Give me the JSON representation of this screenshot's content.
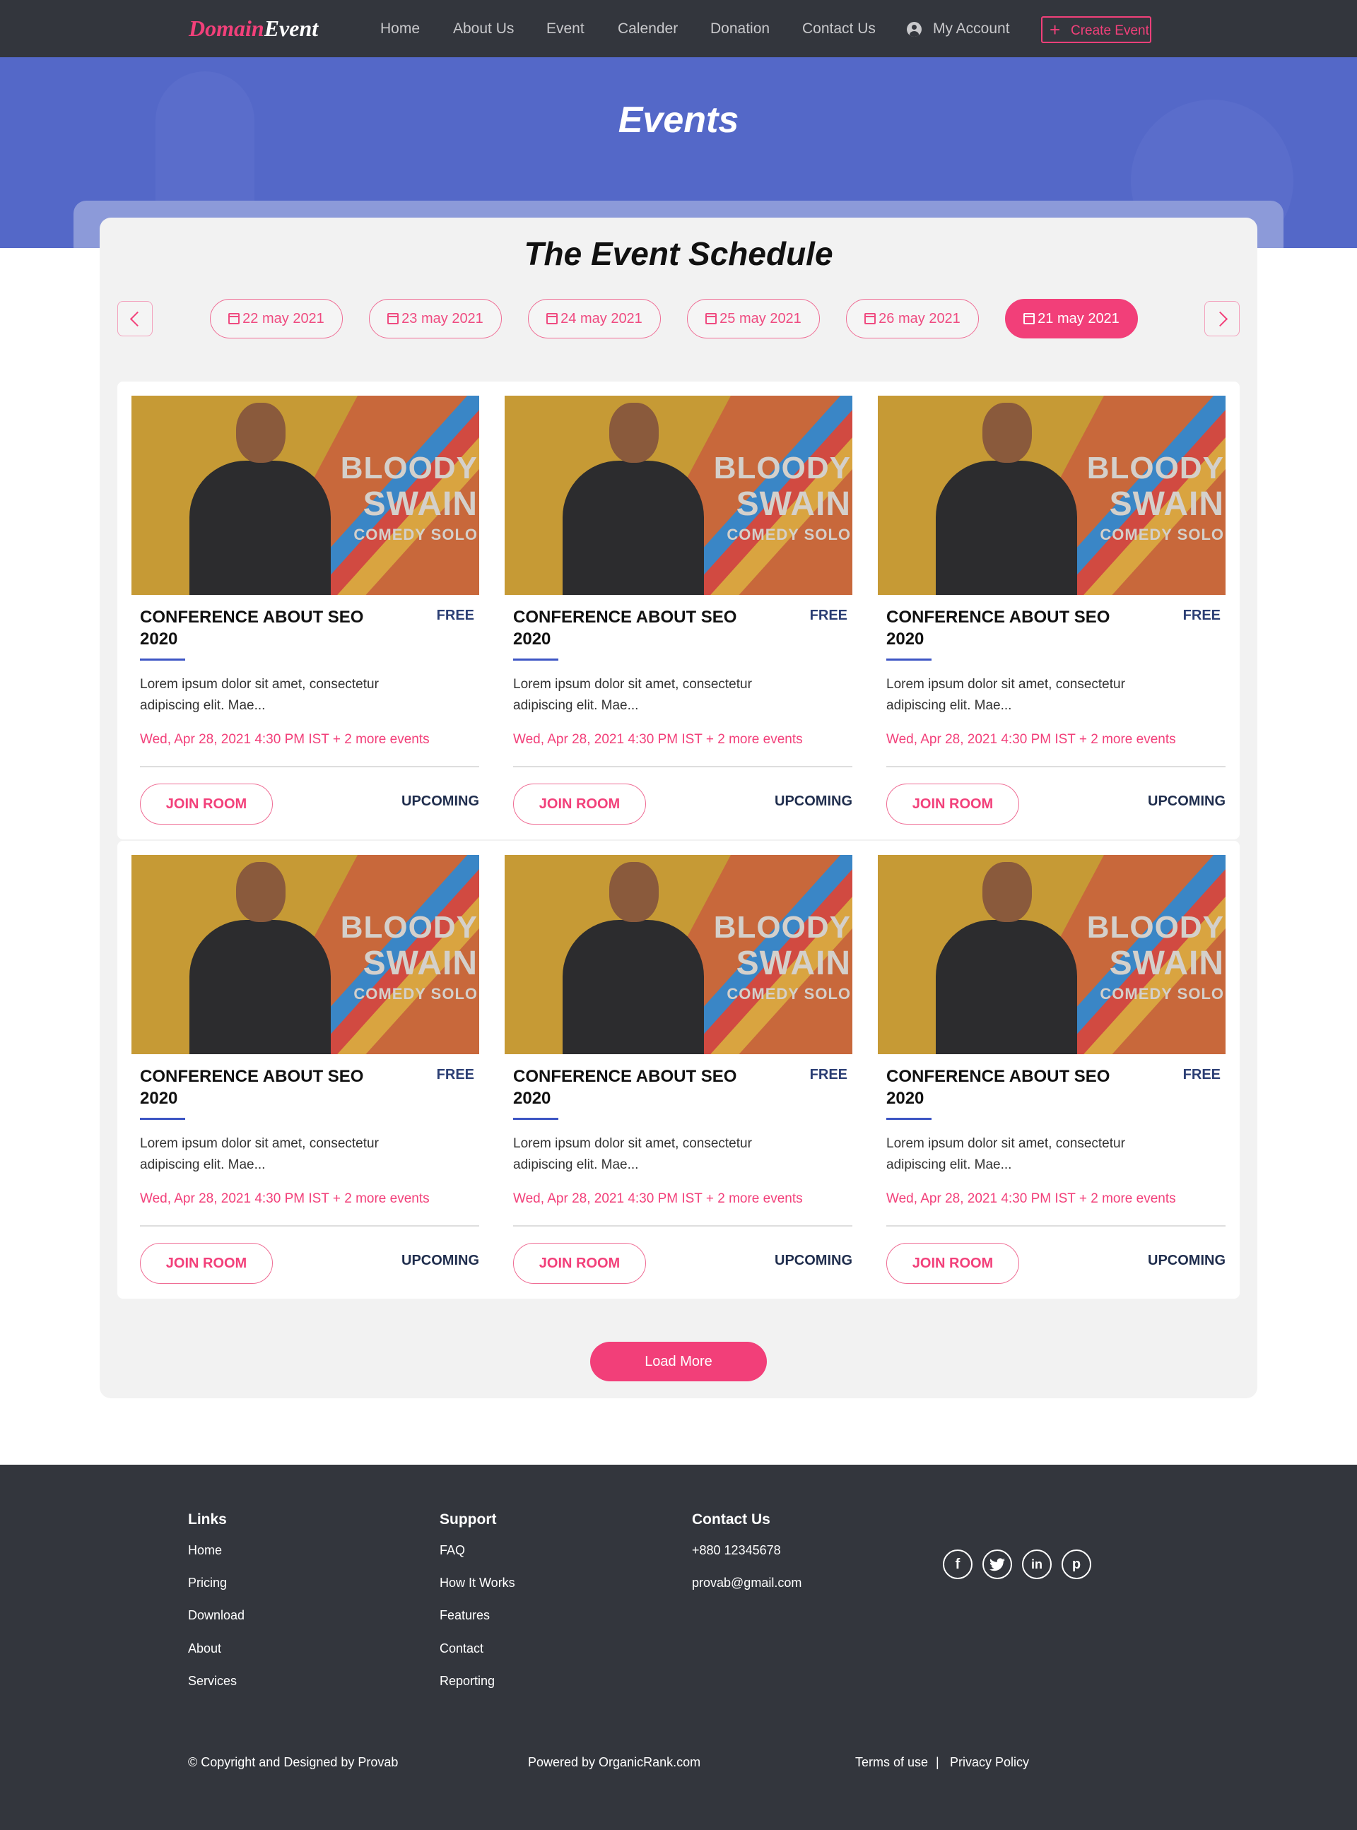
{
  "nav": {
    "logo_part1": "Domain",
    "logo_part2": "Event",
    "items": [
      "Home",
      "About Us",
      "Event",
      "Calender",
      "Donation",
      "Contact Us"
    ],
    "account_label": "My Account",
    "create_label": "Create Event"
  },
  "hero": {
    "title": "Events"
  },
  "schedule": {
    "title": "The Event Schedule",
    "dates": [
      "22 may 2021",
      "23 may 2021",
      "24 may 2021",
      "25 may 2021",
      "26 may 2021",
      "21 may 2021"
    ],
    "active_index": 5
  },
  "cards": [
    {
      "title": "CONFERENCE ABOUT SEO 2020",
      "price": "FREE",
      "description": "Lorem ipsum dolor sit amet, consectetur adipiscing elit. Mae...",
      "date": "Wed, Apr 28, 2021 4:30 PM IST + 2 more events",
      "button": "JOIN ROOM",
      "status": "UPCOMING",
      "image_text": [
        "BLOODY",
        "SWAIN",
        "COMEDY SOLO"
      ]
    },
    {
      "title": "CONFERENCE ABOUT SEO 2020",
      "price": "FREE",
      "description": "Lorem ipsum dolor sit amet, consectetur adipiscing elit. Mae...",
      "date": "Wed, Apr 28, 2021 4:30 PM IST + 2 more events",
      "button": "JOIN ROOM",
      "status": "UPCOMING",
      "image_text": [
        "BLOODY",
        "SWAIN",
        "COMEDY SOLO"
      ]
    },
    {
      "title": "CONFERENCE ABOUT SEO 2020",
      "price": "FREE",
      "description": "Lorem ipsum dolor sit amet, consectetur adipiscing elit. Mae...",
      "date": "Wed, Apr 28, 2021 4:30 PM IST + 2 more events",
      "button": "JOIN ROOM",
      "status": "UPCOMING",
      "image_text": [
        "BLOODY",
        "SWAIN",
        "COMEDY SOLO"
      ]
    },
    {
      "title": "CONFERENCE ABOUT SEO 2020",
      "price": "FREE",
      "description": "Lorem ipsum dolor sit amet, consectetur adipiscing elit. Mae...",
      "date": "Wed, Apr 28, 2021 4:30 PM IST + 2 more events",
      "button": "JOIN ROOM",
      "status": "UPCOMING",
      "image_text": [
        "BLOODY",
        "SWAIN",
        "COMEDY SOLO"
      ]
    },
    {
      "title": "CONFERENCE ABOUT SEO 2020",
      "price": "FREE",
      "description": "Lorem ipsum dolor sit amet, consectetur adipiscing elit. Mae...",
      "date": "Wed, Apr 28, 2021 4:30 PM IST + 2 more events",
      "button": "JOIN ROOM",
      "status": "UPCOMING",
      "image_text": [
        "BLOODY",
        "SWAIN",
        "COMEDY SOLO"
      ]
    },
    {
      "title": "CONFERENCE ABOUT SEO 2020",
      "price": "FREE",
      "description": "Lorem ipsum dolor sit amet, consectetur adipiscing elit. Mae...",
      "date": "Wed, Apr 28, 2021 4:30 PM IST + 2 more events",
      "button": "JOIN ROOM",
      "status": "UPCOMING",
      "image_text": [
        "BLOODY",
        "SWAIN",
        "COMEDY SOLO"
      ]
    }
  ],
  "load_more": "Load More",
  "footer": {
    "links_title": "Links",
    "links": [
      "Home",
      "Pricing",
      "Download",
      "About",
      "Services"
    ],
    "support_title": "Support",
    "support": [
      "FAQ",
      "How It Works",
      "Features",
      "Contact",
      "Reporting"
    ],
    "contact_title": "Contact Us",
    "phone": "+880 12345678",
    "email": "provab@gmail.com",
    "social": [
      "facebook-icon",
      "twitter-icon",
      "linkedin-icon",
      "pinterest-icon"
    ],
    "copyright": "© Copyright and Designed by Provab",
    "powered": "Powered by OrganicRank.com",
    "terms": "Terms of use",
    "separator": "|",
    "privacy": "Privacy Policy"
  },
  "colors": {
    "accent": "#f2407a",
    "hero": "#5468c8",
    "nav": "#33363d",
    "navy": "#2b3e74"
  }
}
